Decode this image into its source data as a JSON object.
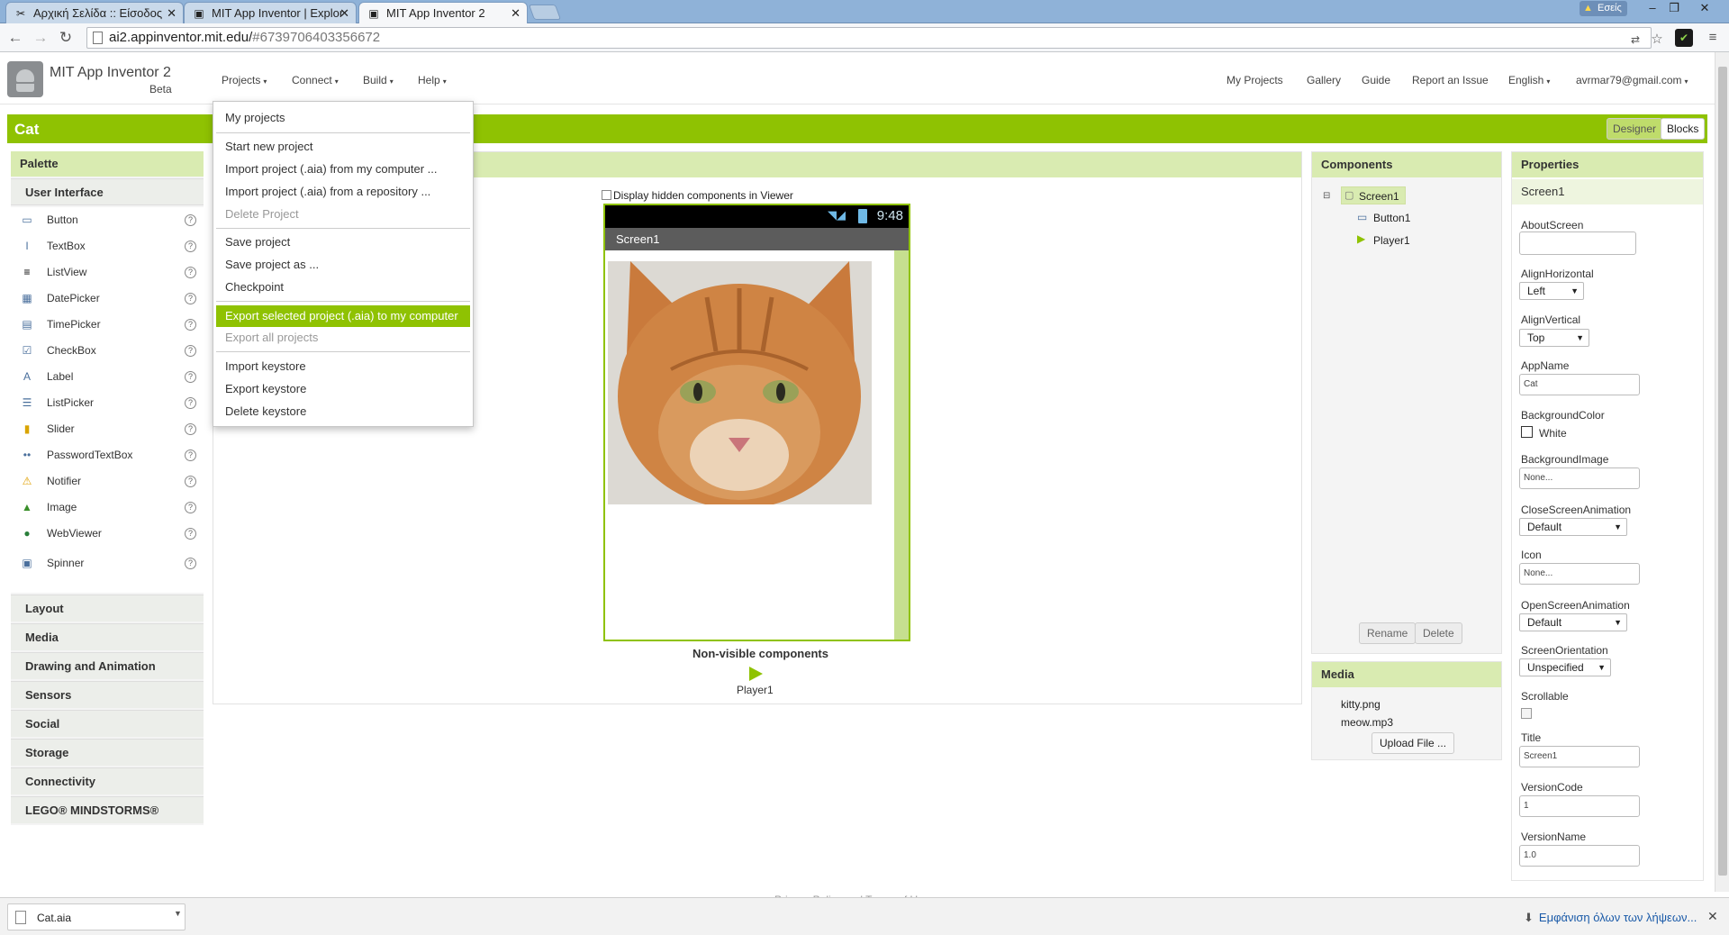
{
  "browser": {
    "tabs": [
      {
        "title": "Αρχική Σελίδα :: Είσοδος",
        "active": false
      },
      {
        "title": "MIT App Inventor | Explor",
        "active": false
      },
      {
        "title": "MIT App Inventor 2",
        "active": true
      }
    ],
    "user_chip": "Εσείς",
    "url_host": "ai2.appinventor.mit.edu/",
    "url_path": "#6739706403356672"
  },
  "app": {
    "brand": "MIT App Inventor 2",
    "beta": "Beta",
    "menus": [
      "Projects",
      "Connect",
      "Build",
      "Help"
    ],
    "right_links": [
      "My Projects",
      "Gallery",
      "Guide",
      "Report an Issue",
      "English"
    ],
    "user": "avrmar79@gmail.com",
    "project_name": "Cat",
    "designer_label": "Designer",
    "blocks_label": "Blocks"
  },
  "projects_menu": {
    "groups": [
      [
        {
          "label": "My projects",
          "disabled": false
        }
      ],
      [
        {
          "label": "Start new project",
          "disabled": false
        },
        {
          "label": "Import project (.aia) from my computer ...",
          "disabled": false
        },
        {
          "label": "Import project (.aia) from a repository ...",
          "disabled": false
        },
        {
          "label": "Delete Project",
          "disabled": true
        }
      ],
      [
        {
          "label": "Save project",
          "disabled": false
        },
        {
          "label": "Save project as ...",
          "disabled": false
        },
        {
          "label": "Checkpoint",
          "disabled": false
        }
      ],
      [
        {
          "label": "Export selected project (.aia) to my computer",
          "disabled": false,
          "highlighted": true
        },
        {
          "label": "Export all projects",
          "disabled": true
        }
      ],
      [
        {
          "label": "Import keystore",
          "disabled": false
        },
        {
          "label": "Export keystore",
          "disabled": false
        },
        {
          "label": "Delete keystore",
          "disabled": false
        }
      ]
    ]
  },
  "palette": {
    "title": "Palette",
    "open_category": "User Interface",
    "items": [
      {
        "label": "Button",
        "icon": "button-icon"
      },
      {
        "label": "TextBox",
        "icon": "textbox-icon"
      },
      {
        "label": "ListView",
        "icon": "listview-icon"
      },
      {
        "label": "DatePicker",
        "icon": "datepicker-icon"
      },
      {
        "label": "TimePicker",
        "icon": "timepicker-icon"
      },
      {
        "label": "CheckBox",
        "icon": "checkbox-icon"
      },
      {
        "label": "Label",
        "icon": "label-icon"
      },
      {
        "label": "ListPicker",
        "icon": "listpicker-icon"
      },
      {
        "label": "Slider",
        "icon": "slider-icon"
      },
      {
        "label": "PasswordTextBox",
        "icon": "passwordtextbox-icon"
      },
      {
        "label": "Notifier",
        "icon": "notifier-icon"
      },
      {
        "label": "Image",
        "icon": "image-icon"
      },
      {
        "label": "WebViewer",
        "icon": "webviewer-icon"
      },
      {
        "label": "Spinner",
        "icon": "spinner-icon"
      }
    ],
    "categories": [
      "Layout",
      "Media",
      "Drawing and Animation",
      "Sensors",
      "Social",
      "Storage",
      "Connectivity",
      "LEGO® MINDSTORMS®"
    ]
  },
  "viewer": {
    "hidden_checkbox_label": "Display hidden components in Viewer",
    "status_time": "9:48",
    "screen_title": "Screen1",
    "nonvisible_label": "Non-visible components",
    "nonvisible_items": [
      "Player1"
    ]
  },
  "components": {
    "title": "Components",
    "tree": [
      "Screen1",
      "Button1",
      "Player1"
    ],
    "rename_label": "Rename",
    "delete_label": "Delete"
  },
  "media": {
    "title": "Media",
    "files": [
      "kitty.png",
      "meow.mp3"
    ],
    "upload_label": "Upload File ..."
  },
  "properties": {
    "title": "Properties",
    "component": "Screen1",
    "AboutScreen": {
      "label": "AboutScreen",
      "value": ""
    },
    "AlignHorizontal": {
      "label": "AlignHorizontal",
      "value": "Left"
    },
    "AlignVertical": {
      "label": "AlignVertical",
      "value": "Top"
    },
    "AppName": {
      "label": "AppName",
      "value": "Cat"
    },
    "BackgroundColor": {
      "label": "BackgroundColor",
      "value": "White"
    },
    "BackgroundImage": {
      "label": "BackgroundImage",
      "value": "None..."
    },
    "CloseScreenAnimation": {
      "label": "CloseScreenAnimation",
      "value": "Default"
    },
    "Icon": {
      "label": "Icon",
      "value": "None..."
    },
    "OpenScreenAnimation": {
      "label": "OpenScreenAnimation",
      "value": "Default"
    },
    "ScreenOrientation": {
      "label": "ScreenOrientation",
      "value": "Unspecified"
    },
    "Scrollable": {
      "label": "Scrollable",
      "checked": false
    },
    "Title": {
      "label": "Title",
      "value": "Screen1"
    },
    "VersionCode": {
      "label": "VersionCode",
      "value": "1"
    },
    "VersionName": {
      "label": "VersionName",
      "value": "1.0"
    }
  },
  "footer_text": "Privacy Policy and Terms of Use",
  "downloads": {
    "file": "Cat.aia",
    "show_all": "Εμφάνιση όλων των λήψεων..."
  },
  "colors": {
    "accent_green": "#8fc202",
    "panel_header": "#d9ebb1",
    "tab_strip": "#8fb2d8"
  }
}
